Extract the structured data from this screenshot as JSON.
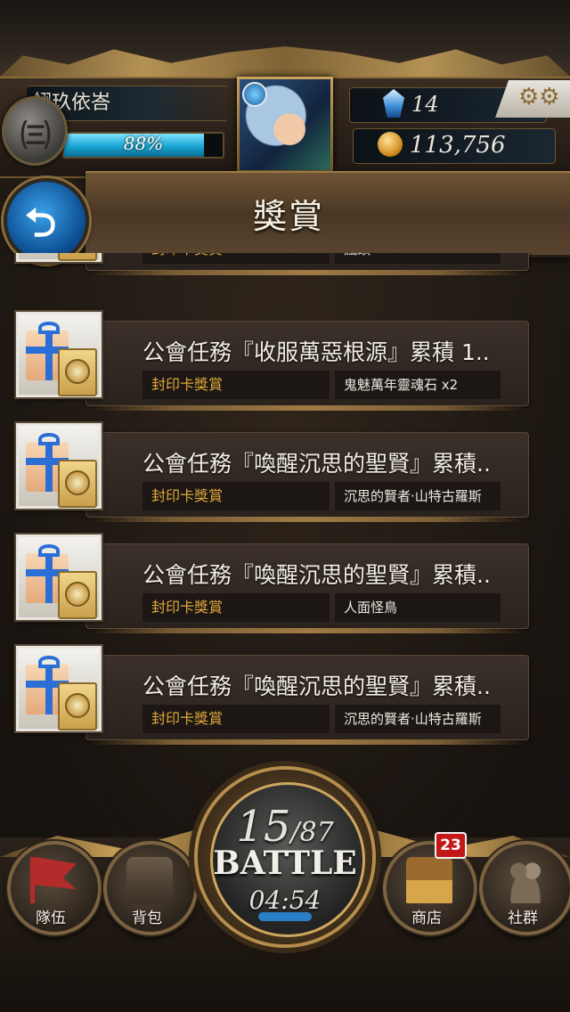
{
  "player": {
    "name": "翎玖依峇",
    "rank_glyph": "㈢",
    "exp_percent": 88,
    "exp_label": "88%"
  },
  "currency": {
    "gems": "14",
    "coins": "113,756"
  },
  "header": {
    "title": "獎賞",
    "back_glyph": "⮌",
    "settings_glyph": "⚙⚙"
  },
  "rewards": [
    {
      "title": "",
      "type": "封印卡獎賞",
      "reward": "瘋頭"
    },
    {
      "title": "公會任務『收服萬惡根源』累積 1..",
      "type": "封印卡獎賞",
      "reward": "鬼魅萬年靈魂石 x2"
    },
    {
      "title": "公會任務『喚醒沉思的聖賢』累積..",
      "type": "封印卡獎賞",
      "reward": "沉思的賢者‧山特古羅斯"
    },
    {
      "title": "公會任務『喚醒沉思的聖賢』累積..",
      "type": "封印卡獎賞",
      "reward": "人面怪鳥"
    },
    {
      "title": "公會任務『喚醒沉思的聖賢』累積..",
      "type": "封印卡獎賞",
      "reward": "沉思的賢者‧山特古羅斯"
    }
  ],
  "nav": {
    "team": "隊伍",
    "bag": "背包",
    "shop": "商店",
    "shop_badge": "23",
    "social": "社群"
  },
  "battle": {
    "stamina_current": "15",
    "stamina_max": "/87",
    "label": "BATTLE",
    "timer": "04:54"
  },
  "colors": {
    "accent_gold": "#caa45d",
    "type_text": "#e0a93a",
    "exp_bar": "#1aa6d4",
    "badge_red": "#c41818"
  }
}
